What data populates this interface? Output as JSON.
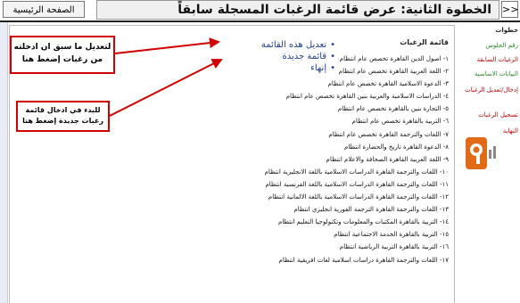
{
  "header": {
    "home_button": "الصفحة الرئيسية",
    "title": "الخطوة الثانية: عرض قائمة الرغبات المسجلة سابقاً",
    "nav_arrow": ">>"
  },
  "list": {
    "header": "قائمة الرغبات",
    "items": [
      "١- اصول الدين القاهرة تخصص عام انتظام",
      "٢- اللغة العربية القاهرة تخصص عام انتظام",
      "٣- الدعوة الاسلامية القاهرة تخصص عام انتظام",
      "٤- الدراسات الاسلامية والعربية بنين القاهرة تخصص عام انتظام",
      "٥- التجارة بنين بالقاهرة تخصص عام انتظام",
      "٦- التربية بالقاهرة تخصص عام انتظام",
      "٧- اللغات والترجمة القاهرة تخصص عام انتظام",
      "٨- الدعوة القاهرة تاريخ والحضارة انتظام",
      "٩- اللغة العربية القاهرة الصحافة والاعلام انتظام",
      "١٠- اللغات والترجمة القاهرة الدراسات الاسلامية باللغة الانجليزية انتظام",
      "١١- اللغات والترجمة القاهرة الدراسات الاسلامية باللغة الفرنسية انتظام",
      "١٢- اللغات والترجمة القاهرة الدراسات الاسلامية باللغة الالمانية انتظام",
      "١٣- اللغات والترجمة القاهرة الترجمة الفورية انجليزي انتظام",
      "١٤- التربية بالقاهرة المكتبات والمعلومات وتكنولوجيا التعليم انتظام",
      "١٥- التربية بالقاهرة الخدمة الاجتماعية انتظام",
      "١٦- التربية بالقاهرة التربية الرياضية انتظام",
      "١٧- اللغات والترجمة القاهرة دراسات اسلامية لغات افريقية انتظام"
    ]
  },
  "links": [
    {
      "label": "تعديل هذه القائمة"
    },
    {
      "label": "قائمة جديدة"
    },
    {
      "label": "إنهاء"
    }
  ],
  "notes": {
    "edit": "لتعديل ما سبق ان ادخلته من رغبات إضغط هنا",
    "new": "للبدء في ادخال قائمة رغبات جديدة إضغط هنا"
  },
  "side": {
    "header": "خطوات",
    "items": [
      {
        "label": "رقم الجلوس",
        "color": "#2a8a2a"
      },
      {
        "label": "الرغبات السابقة",
        "color": "#c00000"
      },
      {
        "label": "البيانات الاساسية",
        "color": "#2a8a2a"
      },
      {
        "label": "إدخال/تعديل الرغبات",
        "color": "#c00000"
      },
      {
        "label": "تسجيل الرغبات",
        "color": "#c00000"
      },
      {
        "label": "النهاية",
        "color": "#c00000"
      }
    ]
  },
  "colors": {
    "link": "#1e3f95",
    "note_border": "#d10000",
    "logo": "#e06a18"
  }
}
